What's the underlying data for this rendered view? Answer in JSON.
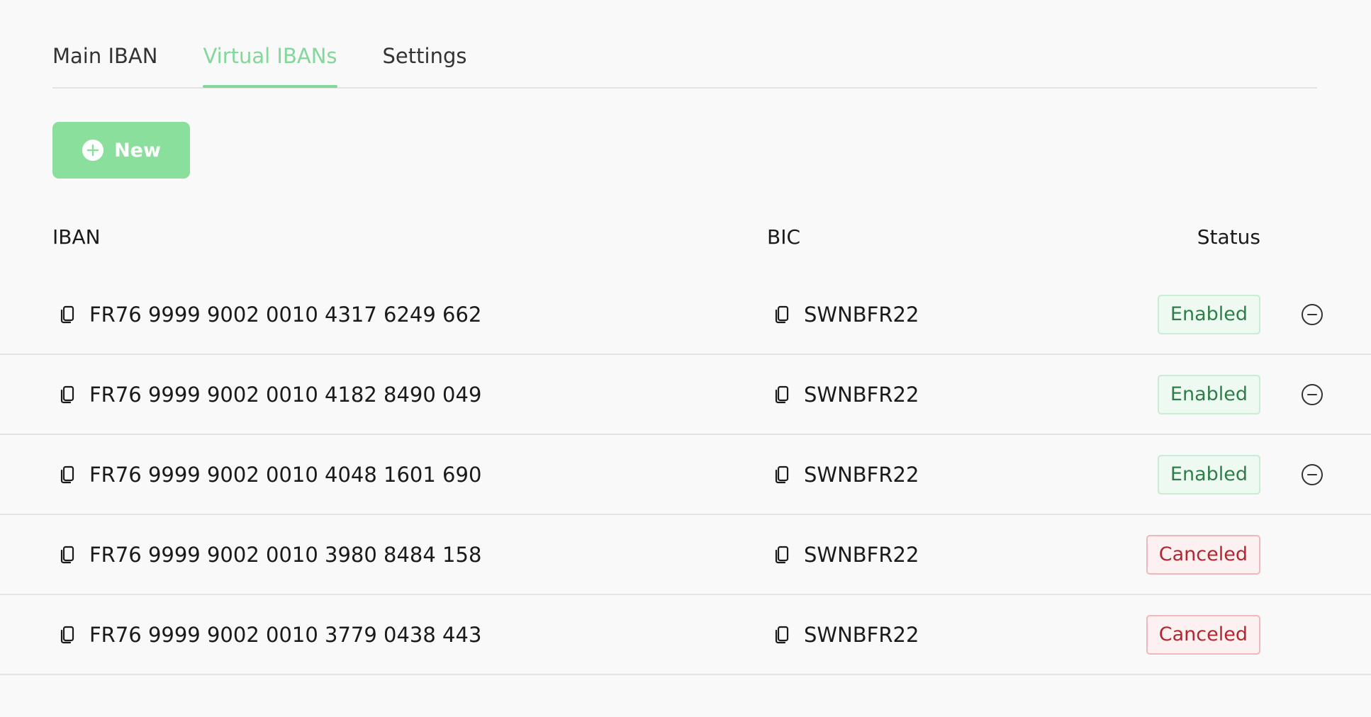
{
  "tabs": [
    {
      "label": "Main IBAN",
      "active": false
    },
    {
      "label": "Virtual IBANs",
      "active": true
    },
    {
      "label": "Settings",
      "active": false
    }
  ],
  "new_button": {
    "label": "New",
    "icon": "plus-circle-icon"
  },
  "table": {
    "headers": {
      "iban": "IBAN",
      "bic": "BIC",
      "status": "Status"
    },
    "rows": [
      {
        "iban": "FR76 9999 9002 0010 4317 6249 662",
        "bic": "SWNBFR22",
        "status": "Enabled",
        "removable": true
      },
      {
        "iban": "FR76 9999 9002 0010 4182 8490 049",
        "bic": "SWNBFR22",
        "status": "Enabled",
        "removable": true
      },
      {
        "iban": "FR76 9999 9002 0010 4048 1601 690",
        "bic": "SWNBFR22",
        "status": "Enabled",
        "removable": true
      },
      {
        "iban": "FR76 9999 9002 0010 3980 8484 158",
        "bic": "SWNBFR22",
        "status": "Canceled",
        "removable": false
      },
      {
        "iban": "FR76 9999 9002 0010 3779 0438 443",
        "bic": "SWNBFR22",
        "status": "Canceled",
        "removable": false
      }
    ]
  },
  "colors": {
    "accent": "#83d79a",
    "button_bg": "#8adf9d",
    "enabled_text": "#2f7d4a",
    "canceled_text": "#b3262f",
    "background": "#f9f9f9"
  }
}
